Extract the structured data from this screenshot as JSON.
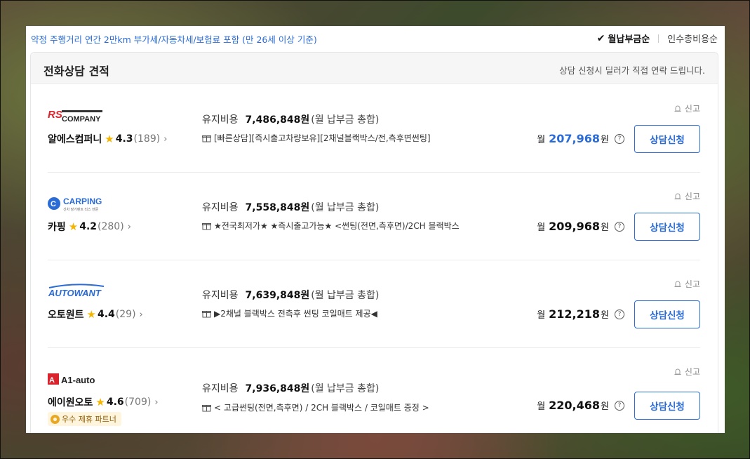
{
  "top": {
    "note": "약정 주행거리 연간 2만km 부가세/자동차세/보험료 포함 (만 26세 이상 기준)",
    "sort_active": "월납부금순",
    "sort_other": "인수총비용순"
  },
  "section": {
    "title": "전화상담 견적",
    "subtitle": "상담 신청시 딜러가 직접 연락 드립니다."
  },
  "labels": {
    "maintenance": "유지비용",
    "maintenance_note": "(월 납부금 총합)",
    "month": "월",
    "won": "원",
    "report": "신고",
    "consult_button": "상담신청",
    "help": "?"
  },
  "dealers": [
    {
      "logo_text": "COMPANY",
      "name": "알에스컴퍼니",
      "rating": "4.3",
      "count": "(189)",
      "maintenance_amount": "7,486,848원",
      "benefit": "[빠른상담][즉시출고차량보유][2채널블랙박스/전,측후면썬팅]",
      "monthly": "207,968",
      "highlight": true
    },
    {
      "logo_text": "CARPING",
      "logo_sub": "신차 장기렌트 리스 전문",
      "name": "카핑",
      "rating": "4.2",
      "count": "(280)",
      "maintenance_amount": "7,558,848원",
      "benefit": "★전국최저가★ ★즉시출고가능★ <썬팅(전면,측후면)/2CH 블랙박스",
      "monthly": "209,968",
      "highlight": false
    },
    {
      "logo_text": "AUTOWANT",
      "name": "오토원트",
      "rating": "4.4",
      "count": "(29)",
      "maintenance_amount": "7,639,848원",
      "benefit": "▶2채널 블랙박스 전측후 썬팅 코일매트 제공◀",
      "monthly": "212,218",
      "highlight": false
    },
    {
      "logo_text": "A1-auto",
      "name": "에이원오토",
      "rating": "4.6",
      "count": "(709)",
      "partner_badge": "우수 제휴 파트너",
      "maintenance_amount": "7,936,848원",
      "benefit": "< 고급썬팅(전면,측후면) / 2CH 블랙박스 / 코일매트 증정 >",
      "monthly": "220,468",
      "highlight": false
    }
  ],
  "colors": {
    "accent": "#2a6bd6",
    "star": "#f5b400",
    "logo_red": "#d9232d"
  }
}
